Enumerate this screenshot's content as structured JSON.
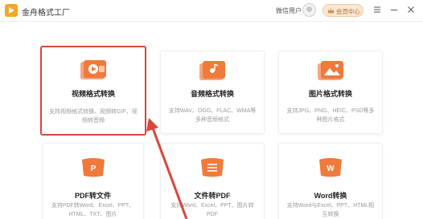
{
  "app": {
    "title": "金舟格式工厂"
  },
  "header": {
    "user_name": "微信用户",
    "vip_label": "会员中心"
  },
  "colors": {
    "accent": "#f07a3a",
    "highlight": "#d9463b",
    "vip_bg": "#fbe7d3"
  },
  "cards": [
    {
      "title": "视频格式转换",
      "desc": "支持视频格式转换、视频转GIF、视频转音频",
      "icon": "video-icon"
    },
    {
      "title": "音频格式转换",
      "desc": "支持WAV、OGG、FLAC、WMA等多种音频格式",
      "icon": "audio-icon"
    },
    {
      "title": "图片格式转换",
      "desc": "支持JPG、PNG、HEIC、PSD等多种图片格式",
      "icon": "image-icon"
    },
    {
      "title": "PDF转文件",
      "desc": "支持PDF转Word、Excel、PPT、HTML、TXT、图片",
      "icon": "pdf-icon"
    },
    {
      "title": "文件转PDF",
      "desc": "支持Word、Excel、PPT、图片转PDF",
      "icon": "file-to-pdf-icon"
    },
    {
      "title": "Word转换",
      "desc": "支持Word与Excel、PPT、HTML相互转换",
      "icon": "word-icon"
    }
  ]
}
